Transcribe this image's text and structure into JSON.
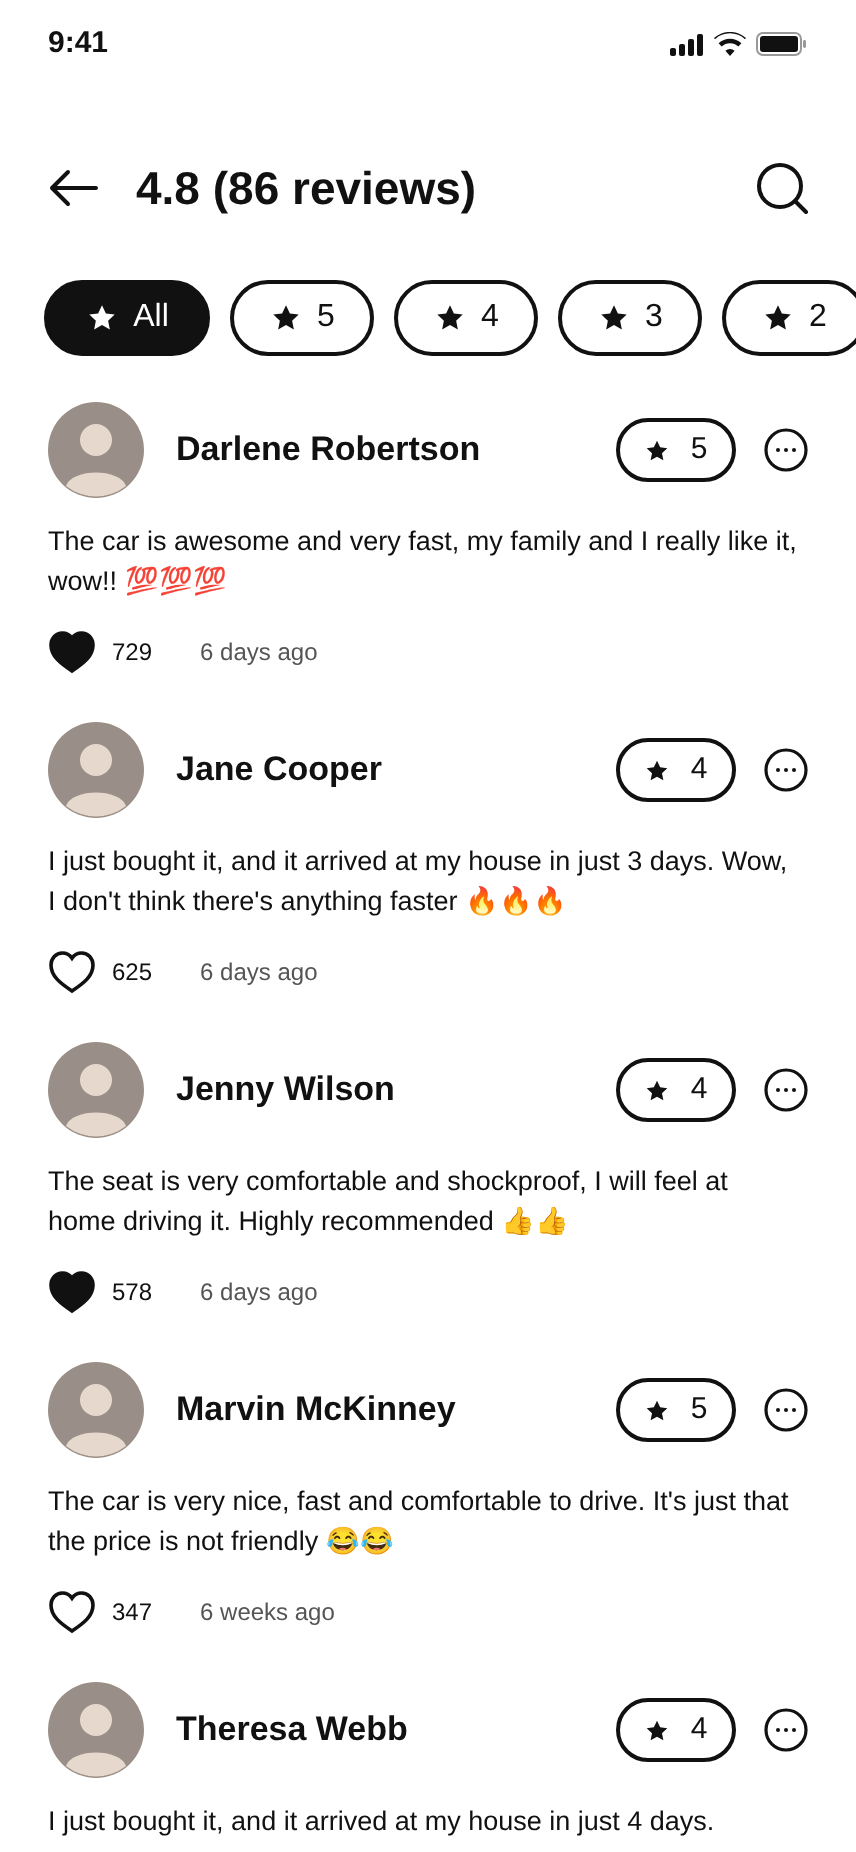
{
  "status_bar": {
    "time": "9:41"
  },
  "header": {
    "title": "4.8 (86 reviews)"
  },
  "filters": [
    {
      "label": "All",
      "selected": true
    },
    {
      "label": "5",
      "selected": false
    },
    {
      "label": "4",
      "selected": false
    },
    {
      "label": "3",
      "selected": false
    },
    {
      "label": "2",
      "selected": false
    }
  ],
  "reviews": [
    {
      "name": "Darlene Robertson",
      "rating": "5",
      "text": "The car is awesome and very fast, my family and I really like it, wow!! 💯💯💯",
      "liked": true,
      "likes": "729",
      "time": "6 days ago"
    },
    {
      "name": "Jane Cooper",
      "rating": "4",
      "text": "I just bought it, and it arrived at my house in just 3 days. Wow, I don't think there's anything faster 🔥🔥🔥",
      "liked": false,
      "likes": "625",
      "time": "6 days ago"
    },
    {
      "name": "Jenny Wilson",
      "rating": "4",
      "text": "The seat is very comfortable and shockproof, I will feel at home driving it. Highly recommended 👍👍",
      "liked": true,
      "likes": "578",
      "time": "6 days ago"
    },
    {
      "name": "Marvin McKinney",
      "rating": "5",
      "text": "The car is very nice, fast and comfortable to drive. It's just that the price is not friendly 😂😂",
      "liked": false,
      "likes": "347",
      "time": "6 weeks ago"
    },
    {
      "name": "Theresa Webb",
      "rating": "4",
      "text": "I just bought it, and it arrived at my house in just 4 days."
    }
  ]
}
